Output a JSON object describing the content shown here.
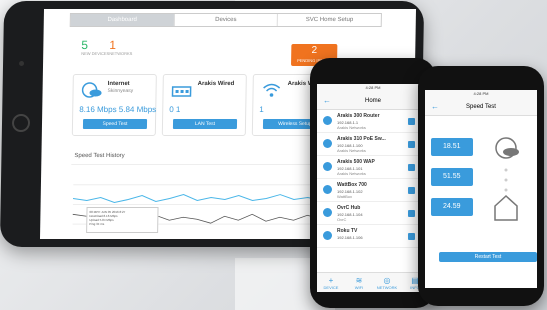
{
  "tablet": {
    "tabs": [
      "Dashboard",
      "Devices",
      "SVC Home Setup"
    ],
    "stats": [
      {
        "value": "5",
        "label": "NEW DEVICES",
        "color": "#2eb86a"
      },
      {
        "value": "1",
        "label": "NETWORKS",
        "color": "#f0731f"
      }
    ],
    "alert": {
      "value": "2",
      "label": "PENDING ISSUES"
    },
    "cards": [
      {
        "title": "Internet",
        "sub": "Skinnyeasy",
        "vals": "8.16 Mbps  5.84 Mbps",
        "button": "Speed Test"
      },
      {
        "title": "Arakis Wired",
        "sub": "",
        "vals": "0     1",
        "button": "LAN Test"
      },
      {
        "title": "Arakis Wireless",
        "sub": "",
        "vals": "1",
        "button": "Wireless Setup"
      }
    ],
    "history_title": "Speed Test History",
    "tooltip": [
      "08 MPH JUN 05 2016 8:27",
      "Download  8.16 Mbps",
      "Upload  5.84 Mbps",
      "Ping  34 ms"
    ]
  },
  "phone1": {
    "time": "4:28 PM",
    "title": "Home",
    "devices": [
      {
        "name": "Arakis 300 Router",
        "ip": "192.168.1.1",
        "vendor": "Arakis Networks"
      },
      {
        "name": "Arakis 310 PoE Sw...",
        "ip": "192.168.1.100",
        "vendor": "Arakis Networks"
      },
      {
        "name": "Arakis 500 WAP",
        "ip": "192.168.1.101",
        "vendor": "Arakis Networks"
      },
      {
        "name": "WattBox 700",
        "ip": "192.168.1.102",
        "vendor": "WattBox"
      },
      {
        "name": "OvrC Hub",
        "ip": "192.168.1.104",
        "vendor": "OvrC"
      },
      {
        "name": "Roku TV",
        "ip": "192.168.1.106",
        "vendor": ""
      }
    ],
    "tabbar": [
      {
        "icon": "+",
        "label": "DEVICE"
      },
      {
        "icon": "≋",
        "label": "WIFI"
      },
      {
        "icon": "◎",
        "label": "NETWORK"
      },
      {
        "icon": "▤",
        "label": "INFO"
      }
    ]
  },
  "phone2": {
    "time": "4:28 PM",
    "title": "Speed Test",
    "rows": [
      "18.51 Mbps",
      "51.55 Mbps",
      "24.59 Mbps"
    ],
    "button": "Restart Test"
  }
}
